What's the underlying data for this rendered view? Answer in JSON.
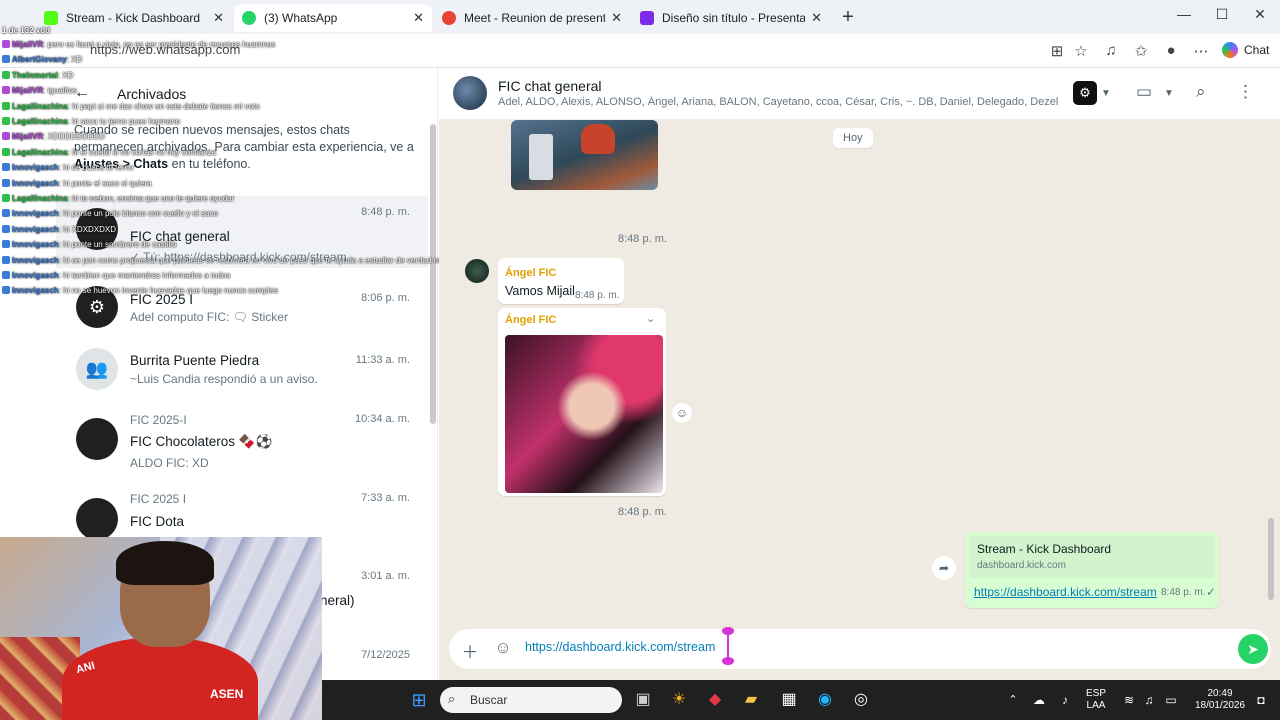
{
  "browser": {
    "tabs": [
      {
        "label": "Stream - Kick Dashboard",
        "color": "#53fc18"
      },
      {
        "label": "(3) WhatsApp",
        "color": "#25d366"
      },
      {
        "label": "Meet - Reunion de presentaci",
        "color": "#ea4335"
      },
      {
        "label": "Diseño sin título - Presentación",
        "color": "#7d2ae8"
      }
    ],
    "url": "https://web.whatsapp.com",
    "copilot_label": "Chat"
  },
  "left_panel": {
    "archived_title": "Archivados",
    "archived_note_a": "Cuando se reciben nuevos mensajes, estos chats permanecen archivados. Para cambiar esta experiencia, ve a ",
    "archived_note_b": "Ajustes > Chats",
    "archived_note_c": " en tu teléfono.",
    "chats": [
      {
        "name": "FIC chat general",
        "sub": "✓ Tú: https://dashboard.kick.com/stream",
        "time": "8:48 p. m."
      },
      {
        "name": "FIC 2025 I",
        "sub": "Adel computo FIC: 🗨 Sticker",
        "time": "8:06 p. m."
      },
      {
        "name": "Burrita Puente Piedra",
        "sub": "~Luis Candia respondió a un aviso.",
        "time": "11:33 a. m."
      },
      {
        "name": "FIC Chocolateros 🍫⚽",
        "group": "FIC 2025-I",
        "sub": "ALDO FIC: XD",
        "time": "10:34 a. m."
      },
      {
        "name": "FIC Dota",
        "group": "FIC 2025 I",
        "sub": "",
        "time": "7:33 a. m."
      },
      {
        "name": "neral)",
        "sub": "",
        "time": "3:01 a. m."
      },
      {
        "name": "",
        "sub": "",
        "time": "7/12/2025"
      }
    ]
  },
  "overlay_chat": [
    {
      "user": "MijaiIVR",
      "msg": ": pero es fauni o viejo, no es ser presidente de recursos huamnos"
    },
    {
      "user": "AlbertGiovany",
      "msg": ": XD"
    },
    {
      "user": "TheInmortal",
      "msg": ": XD"
    },
    {
      "user": "MijaiIVR",
      "msg": ": igualitos"
    },
    {
      "user": "Lagallinachina",
      "msg": ": hi papi si me das chow en este debate tienes mi voto"
    },
    {
      "user": "Lagallinachina",
      "msg": ": hi saca tu terno pues hermano"
    },
    {
      "user": "MijaiIVR",
      "msg": ": XDDDDDDDDD"
    },
    {
      "user": "Lagallinachina",
      "msg": ": hi el suelto si no cortas no hay confianza"
    },
    {
      "user": "Innovigasch",
      "msg": ": hi de busca tu terno"
    },
    {
      "user": "Innovigasch",
      "msg": ": hi ponte el saco si quiera"
    },
    {
      "user": "Lagallinachina",
      "msg": ": hi ta webon, encima que uno te quiere ayudar"
    },
    {
      "user": "Innovigasch",
      "msg": ": hi ponte un polo blanco con cuello y el saco"
    },
    {
      "user": "Innovigasch",
      "msg": ": hi XDXDXDXD"
    },
    {
      "user": "Innovigasch",
      "msg": ": hi ponte un sombrero de castillo"
    },
    {
      "user": "Innovigasch",
      "msg": ": hi oe pon como propuesta que planteas se resolvera en vivo de paso que te ayuda a estudiar de verdad mrd"
    },
    {
      "user": "Innovigasch",
      "msg": ": hi tambien que mantendras informados a todos"
    },
    {
      "user": "Innovigasch",
      "msg": ": hi no se huevon invente huevadas que luego nunca cumples"
    }
  ],
  "overlay_extra": "1 de 132 xdd",
  "chat_header": {
    "title": "FIC chat general",
    "members": "Adel, ALDO, Alexis, ALONSO, Ángel, Ariana, BALON, Cayetano, ccoa, César, Cris, ~. DB, Daniel, Delegado, Dezel, ..."
  },
  "messages": {
    "day_label": "Hoy",
    "ts1": "8:48 p. m.",
    "msg1_sender": "Ángel FIC",
    "msg1_text": "Vamos Mijail",
    "msg1_time": "8:48 p. m.",
    "msg2_sender": "Ángel FIC",
    "ts2": "8:48 p. m.",
    "link_title": "Stream - Kick Dashboard",
    "link_domain": "dashboard.kick.com",
    "link_url": "https://dashboard.kick.com/stream",
    "out_time": "8:48 p. m."
  },
  "composer": {
    "value": "https://dashboard.kick.com/stream"
  },
  "taskbar": {
    "search_label": "Buscar",
    "lang": "ESP",
    "lang2": "LAA",
    "time": "20:49",
    "date": "18/01/2026"
  },
  "webcam": {
    "shirt_text": "ASEN",
    "shirt_text2": "ANI"
  }
}
